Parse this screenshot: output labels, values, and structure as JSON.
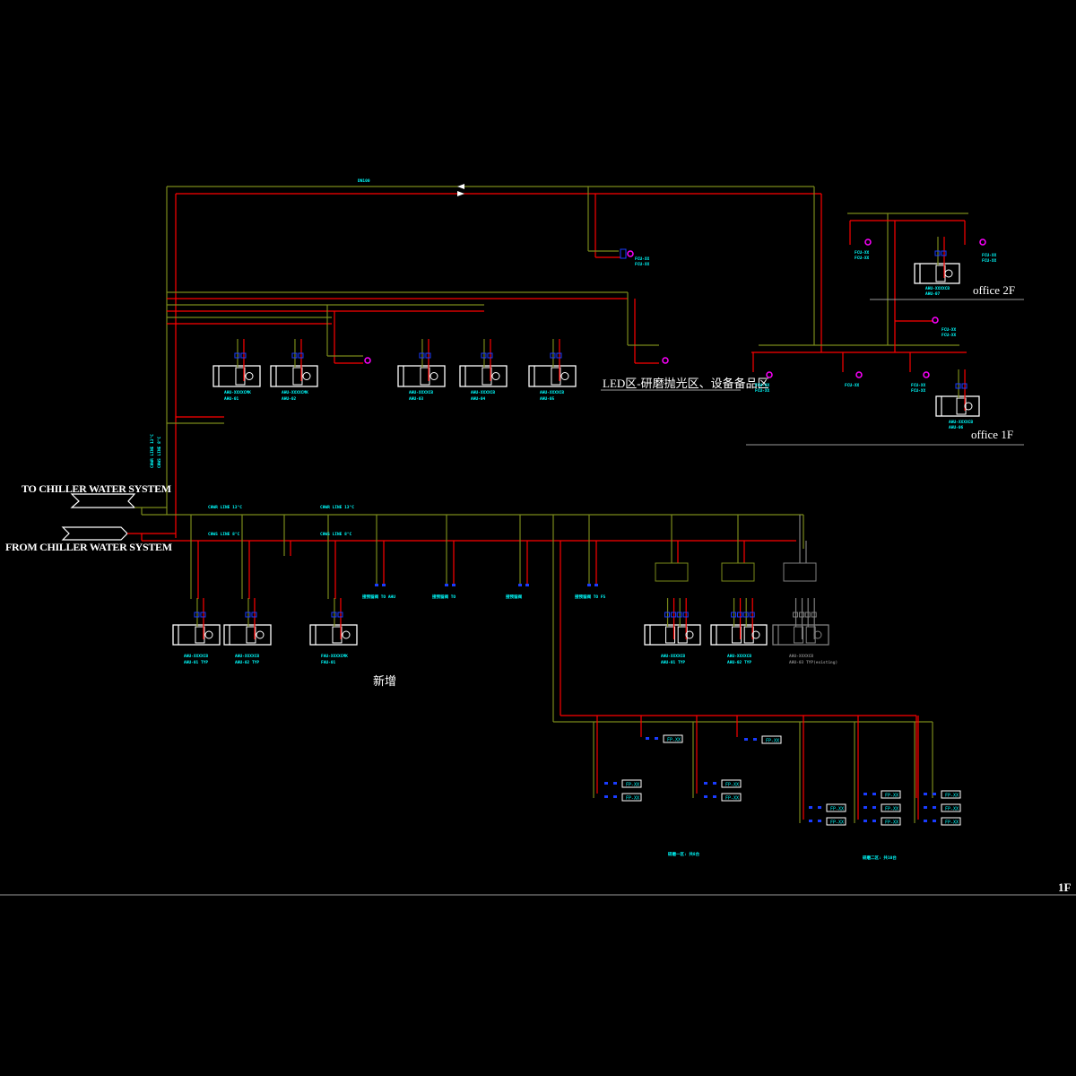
{
  "drawing": {
    "sheet_label": "1F",
    "colors": {
      "background": "#000000",
      "supply_pipe": "#ff0000",
      "return_pipe": "#7a8a1a",
      "valve": "#1a3cff",
      "label": "#00ffff",
      "fixture": "#ffffff",
      "fan_coil_terminal": "#ff00ff",
      "existing_unit": "#808080",
      "divider": "#9a9a9a"
    },
    "chiller": {
      "to_label": "TO CHILLER WATER SYSTEM",
      "from_label": "FROM CHILLER WATER SYSTEM"
    },
    "headers": {
      "return_line_label_left": "CHWR LINE 13°C",
      "return_line_label_right": "CHWR LINE 13°C",
      "supply_line_label_left": "CHWS LINE 8°C",
      "supply_line_label_right": "CHWS LINE 8°C",
      "riser_label_a": "CHWR LINE 13°C",
      "riser_label_b": "CHWS LINE 8°C",
      "top_header_size": "DN100"
    },
    "zones": {
      "led_zone": "LED区-研磨抛光区、设备备品区",
      "office_2f": "office 2F",
      "office_1f": "office 1F",
      "new_addition": "新增"
    },
    "upper_ahus": [
      {
        "model": "AHU-XXXXCMK",
        "tag": "AHU-01"
      },
      {
        "model": "AHU-XXXXCMK",
        "tag": "AHU-02"
      },
      {
        "model": "AHU-XXXXCB",
        "tag": "AHU-03"
      },
      {
        "model": "AHU-XXXXCB",
        "tag": "AHU-04"
      },
      {
        "model": "AHU-XXXXCB",
        "tag": "AHU-05"
      }
    ],
    "office_ahus": [
      {
        "model": "AHU-XXXXCB",
        "tag": "AHU-07"
      },
      {
        "model": "AHU-XXXXCB",
        "tag": "AHU-06"
      }
    ],
    "lower_ahus": [
      {
        "model": "AHU-XXXXCB",
        "tag": "AHU-01 TYP"
      },
      {
        "model": "AHU-XXXXCB",
        "tag": "AHU-02 TYP"
      },
      {
        "model": "FAU-XXXXCMK",
        "tag": "FAU-01"
      }
    ],
    "double_coil_ahus": [
      {
        "model": "AHU-XXXXCB",
        "tag": "AHU-01 TYP",
        "existing": false
      },
      {
        "model": "AHU-XXXXCB",
        "tag": "AHU-02 TYP",
        "existing": false
      },
      {
        "model": "AHU-XXXXCB",
        "tag": "AHU-03 TYP(existing)",
        "existing": true
      }
    ],
    "fcu_terminals": [
      {
        "line1": "FCU-XX",
        "line2": "FCU-XX"
      },
      {
        "line1": "FCU-XX",
        "line2": "FCU-XX"
      },
      {
        "line1": "FCU-XX",
        "line2": ""
      },
      {
        "line1": "FCU-XX",
        "line2": "FCU-XX"
      },
      {
        "line1": "FCU-XX",
        "line2": "FCU-XX"
      },
      {
        "line1": "FCU-XX",
        "line2": "FCU-XX"
      },
      {
        "line1": "FCU-XX",
        "line2": "FCU-XX"
      }
    ],
    "drops": [
      {
        "label": "接预留阀 TO AHU"
      },
      {
        "label": "接预留阀 TO"
      },
      {
        "label": "接预留阀"
      },
      {
        "label": "接预留阀 TO FS"
      }
    ],
    "fcu_box_label": "FP-XX",
    "fcu_groups": [
      {
        "label": "研磨一区: 共8台"
      },
      {
        "label": "研磨二区: 共10台"
      }
    ]
  }
}
